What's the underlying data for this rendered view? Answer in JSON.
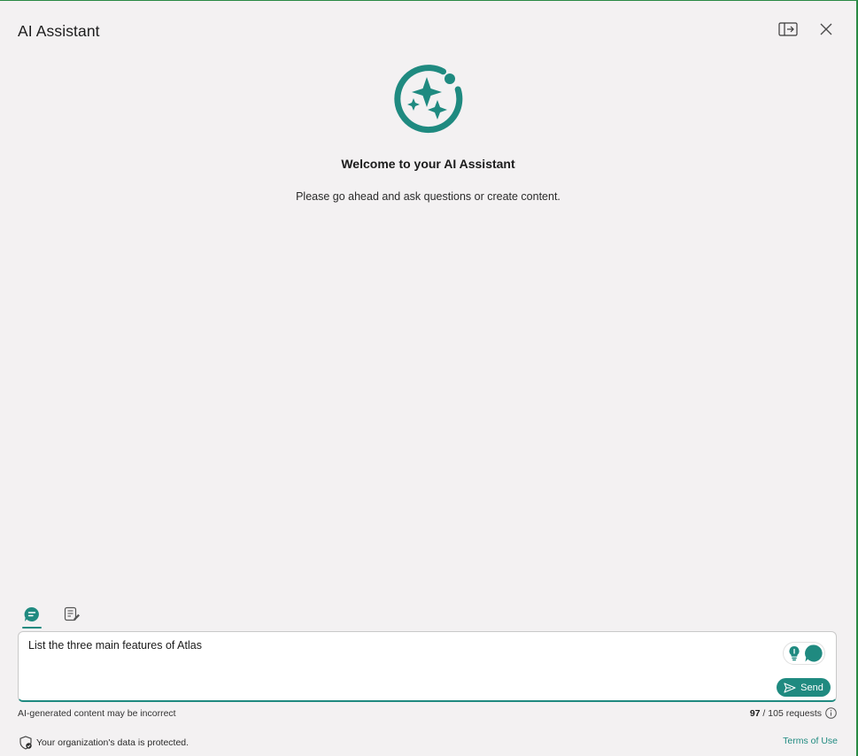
{
  "header": {
    "title": "AI Assistant",
    "undock_icon": "undock-panel-icon",
    "close_icon": "close-icon"
  },
  "hero": {
    "icon": "sparkle-assistant-icon",
    "welcome": "Welcome to your AI Assistant",
    "subtitle": "Please go ahead and ask questions or create content."
  },
  "modes": {
    "chat_icon": "chat-bubble-icon",
    "notes_icon": "notes-edit-icon",
    "active": "chat"
  },
  "composer": {
    "value": "List the three main features of Atlas",
    "placeholder": "",
    "suggest_icon": "lightbulb-icon",
    "assistant_icon": "assistant-bubble-icon",
    "send_label": "Send",
    "send_icon": "send-icon"
  },
  "footer": {
    "disclaimer": "AI-generated content may be incorrect",
    "requests_used": "97",
    "requests_separator": " / ",
    "requests_total": "105 requests",
    "info_icon": "info-icon",
    "protected_text": "Your organization's data is protected.",
    "shield_icon": "shield-check-icon",
    "terms_label": "Terms of Use"
  },
  "colors": {
    "accent": "#1f8a80",
    "background": "#f3f1f2",
    "frame_border": "#2a8a44"
  }
}
